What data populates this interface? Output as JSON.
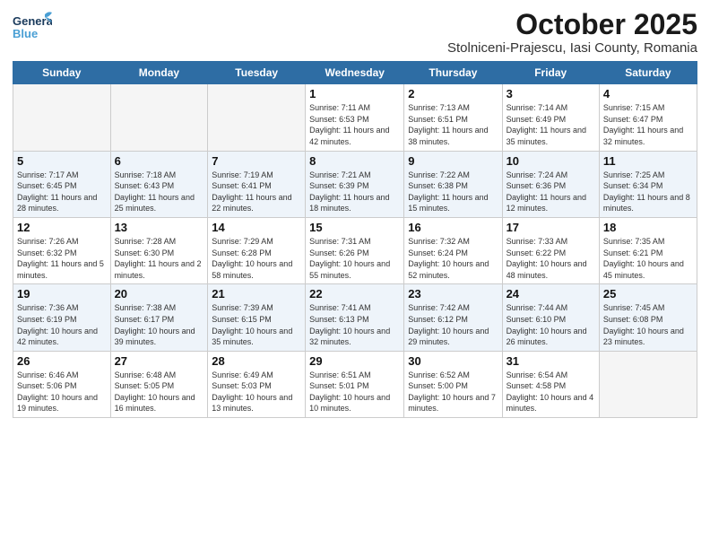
{
  "header": {
    "logo_line1": "General",
    "logo_line2": "Blue",
    "month": "October 2025",
    "location": "Stolniceni-Prajescu, Iasi County, Romania"
  },
  "days_of_week": [
    "Sunday",
    "Monday",
    "Tuesday",
    "Wednesday",
    "Thursday",
    "Friday",
    "Saturday"
  ],
  "weeks": [
    [
      {
        "num": "",
        "info": ""
      },
      {
        "num": "",
        "info": ""
      },
      {
        "num": "",
        "info": ""
      },
      {
        "num": "1",
        "info": "Sunrise: 7:11 AM\nSunset: 6:53 PM\nDaylight: 11 hours and 42 minutes."
      },
      {
        "num": "2",
        "info": "Sunrise: 7:13 AM\nSunset: 6:51 PM\nDaylight: 11 hours and 38 minutes."
      },
      {
        "num": "3",
        "info": "Sunrise: 7:14 AM\nSunset: 6:49 PM\nDaylight: 11 hours and 35 minutes."
      },
      {
        "num": "4",
        "info": "Sunrise: 7:15 AM\nSunset: 6:47 PM\nDaylight: 11 hours and 32 minutes."
      }
    ],
    [
      {
        "num": "5",
        "info": "Sunrise: 7:17 AM\nSunset: 6:45 PM\nDaylight: 11 hours and 28 minutes."
      },
      {
        "num": "6",
        "info": "Sunrise: 7:18 AM\nSunset: 6:43 PM\nDaylight: 11 hours and 25 minutes."
      },
      {
        "num": "7",
        "info": "Sunrise: 7:19 AM\nSunset: 6:41 PM\nDaylight: 11 hours and 22 minutes."
      },
      {
        "num": "8",
        "info": "Sunrise: 7:21 AM\nSunset: 6:39 PM\nDaylight: 11 hours and 18 minutes."
      },
      {
        "num": "9",
        "info": "Sunrise: 7:22 AM\nSunset: 6:38 PM\nDaylight: 11 hours and 15 minutes."
      },
      {
        "num": "10",
        "info": "Sunrise: 7:24 AM\nSunset: 6:36 PM\nDaylight: 11 hours and 12 minutes."
      },
      {
        "num": "11",
        "info": "Sunrise: 7:25 AM\nSunset: 6:34 PM\nDaylight: 11 hours and 8 minutes."
      }
    ],
    [
      {
        "num": "12",
        "info": "Sunrise: 7:26 AM\nSunset: 6:32 PM\nDaylight: 11 hours and 5 minutes."
      },
      {
        "num": "13",
        "info": "Sunrise: 7:28 AM\nSunset: 6:30 PM\nDaylight: 11 hours and 2 minutes."
      },
      {
        "num": "14",
        "info": "Sunrise: 7:29 AM\nSunset: 6:28 PM\nDaylight: 10 hours and 58 minutes."
      },
      {
        "num": "15",
        "info": "Sunrise: 7:31 AM\nSunset: 6:26 PM\nDaylight: 10 hours and 55 minutes."
      },
      {
        "num": "16",
        "info": "Sunrise: 7:32 AM\nSunset: 6:24 PM\nDaylight: 10 hours and 52 minutes."
      },
      {
        "num": "17",
        "info": "Sunrise: 7:33 AM\nSunset: 6:22 PM\nDaylight: 10 hours and 48 minutes."
      },
      {
        "num": "18",
        "info": "Sunrise: 7:35 AM\nSunset: 6:21 PM\nDaylight: 10 hours and 45 minutes."
      }
    ],
    [
      {
        "num": "19",
        "info": "Sunrise: 7:36 AM\nSunset: 6:19 PM\nDaylight: 10 hours and 42 minutes."
      },
      {
        "num": "20",
        "info": "Sunrise: 7:38 AM\nSunset: 6:17 PM\nDaylight: 10 hours and 39 minutes."
      },
      {
        "num": "21",
        "info": "Sunrise: 7:39 AM\nSunset: 6:15 PM\nDaylight: 10 hours and 35 minutes."
      },
      {
        "num": "22",
        "info": "Sunrise: 7:41 AM\nSunset: 6:13 PM\nDaylight: 10 hours and 32 minutes."
      },
      {
        "num": "23",
        "info": "Sunrise: 7:42 AM\nSunset: 6:12 PM\nDaylight: 10 hours and 29 minutes."
      },
      {
        "num": "24",
        "info": "Sunrise: 7:44 AM\nSunset: 6:10 PM\nDaylight: 10 hours and 26 minutes."
      },
      {
        "num": "25",
        "info": "Sunrise: 7:45 AM\nSunset: 6:08 PM\nDaylight: 10 hours and 23 minutes."
      }
    ],
    [
      {
        "num": "26",
        "info": "Sunrise: 6:46 AM\nSunset: 5:06 PM\nDaylight: 10 hours and 19 minutes."
      },
      {
        "num": "27",
        "info": "Sunrise: 6:48 AM\nSunset: 5:05 PM\nDaylight: 10 hours and 16 minutes."
      },
      {
        "num": "28",
        "info": "Sunrise: 6:49 AM\nSunset: 5:03 PM\nDaylight: 10 hours and 13 minutes."
      },
      {
        "num": "29",
        "info": "Sunrise: 6:51 AM\nSunset: 5:01 PM\nDaylight: 10 hours and 10 minutes."
      },
      {
        "num": "30",
        "info": "Sunrise: 6:52 AM\nSunset: 5:00 PM\nDaylight: 10 hours and 7 minutes."
      },
      {
        "num": "31",
        "info": "Sunrise: 6:54 AM\nSunset: 4:58 PM\nDaylight: 10 hours and 4 minutes."
      },
      {
        "num": "",
        "info": ""
      }
    ]
  ]
}
